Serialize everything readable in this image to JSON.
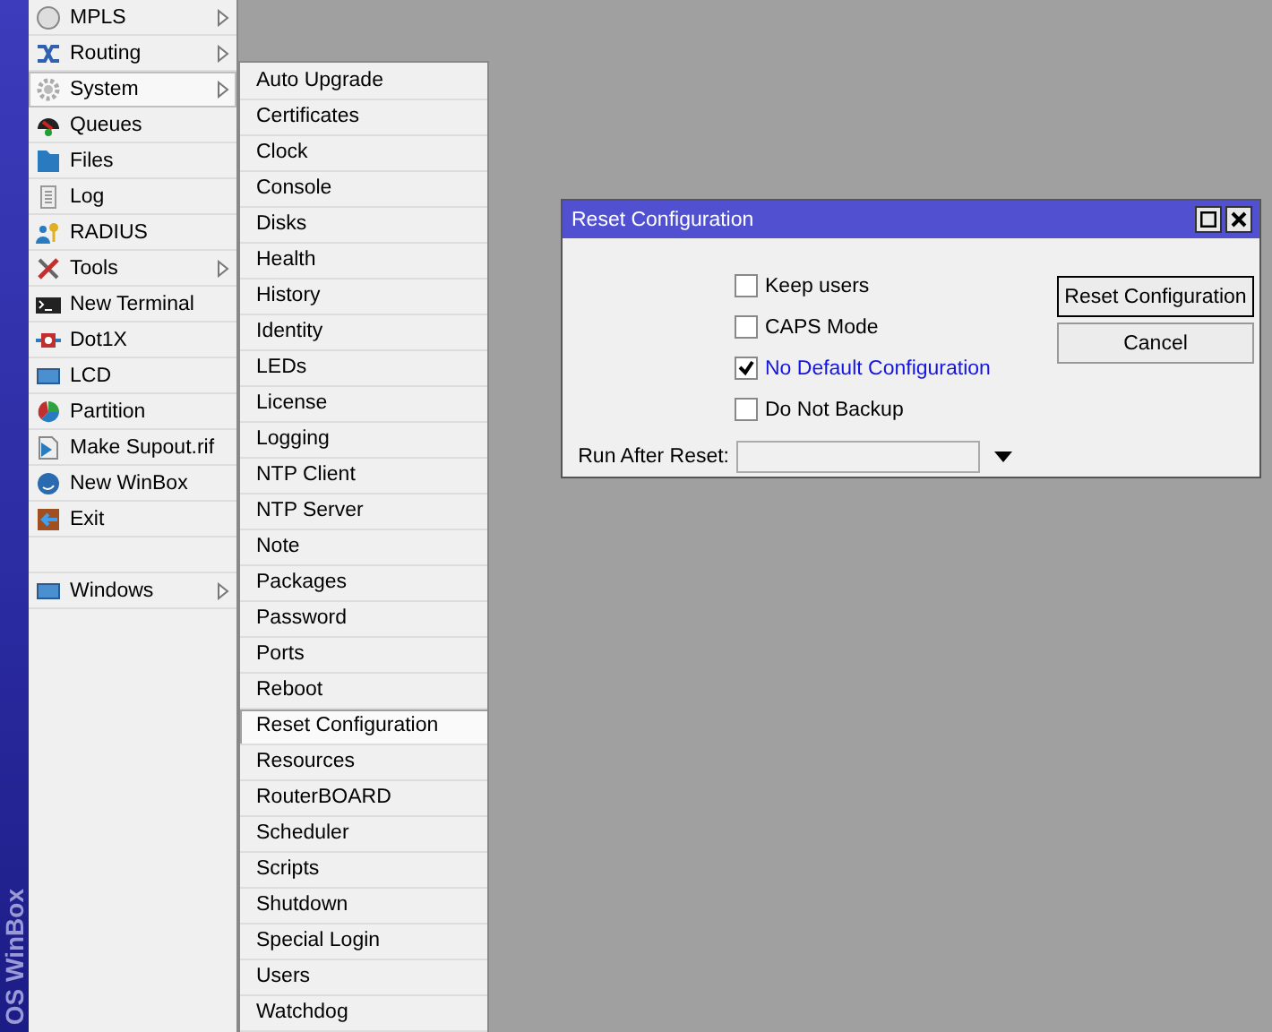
{
  "brand": "OS WinBox",
  "main_menu": [
    {
      "label": "MPLS",
      "has_submenu": true,
      "selected": false
    },
    {
      "label": "Routing",
      "has_submenu": true,
      "selected": false
    },
    {
      "label": "System",
      "has_submenu": true,
      "selected": true
    },
    {
      "label": "Queues",
      "has_submenu": false,
      "selected": false
    },
    {
      "label": "Files",
      "has_submenu": false,
      "selected": false
    },
    {
      "label": "Log",
      "has_submenu": false,
      "selected": false
    },
    {
      "label": "RADIUS",
      "has_submenu": false,
      "selected": false
    },
    {
      "label": "Tools",
      "has_submenu": true,
      "selected": false
    },
    {
      "label": "New Terminal",
      "has_submenu": false,
      "selected": false
    },
    {
      "label": "Dot1X",
      "has_submenu": false,
      "selected": false
    },
    {
      "label": "LCD",
      "has_submenu": false,
      "selected": false
    },
    {
      "label": "Partition",
      "has_submenu": false,
      "selected": false
    },
    {
      "label": "Make Supout.rif",
      "has_submenu": false,
      "selected": false
    },
    {
      "label": "New WinBox",
      "has_submenu": false,
      "selected": false
    },
    {
      "label": "Exit",
      "has_submenu": false,
      "selected": false
    }
  ],
  "bottom_menu": [
    {
      "label": "Windows",
      "has_submenu": true,
      "selected": false
    }
  ],
  "submenu": [
    {
      "label": "Auto Upgrade",
      "selected": false
    },
    {
      "label": "Certificates",
      "selected": false
    },
    {
      "label": "Clock",
      "selected": false
    },
    {
      "label": "Console",
      "selected": false
    },
    {
      "label": "Disks",
      "selected": false
    },
    {
      "label": "Health",
      "selected": false
    },
    {
      "label": "History",
      "selected": false
    },
    {
      "label": "Identity",
      "selected": false
    },
    {
      "label": "LEDs",
      "selected": false
    },
    {
      "label": "License",
      "selected": false
    },
    {
      "label": "Logging",
      "selected": false
    },
    {
      "label": "NTP Client",
      "selected": false
    },
    {
      "label": "NTP Server",
      "selected": false
    },
    {
      "label": "Note",
      "selected": false
    },
    {
      "label": "Packages",
      "selected": false
    },
    {
      "label": "Password",
      "selected": false
    },
    {
      "label": "Ports",
      "selected": false
    },
    {
      "label": "Reboot",
      "selected": false
    },
    {
      "label": "Reset Configuration",
      "selected": true
    },
    {
      "label": "Resources",
      "selected": false
    },
    {
      "label": "RouterBOARD",
      "selected": false
    },
    {
      "label": "Scheduler",
      "selected": false
    },
    {
      "label": "Scripts",
      "selected": false
    },
    {
      "label": "Shutdown",
      "selected": false
    },
    {
      "label": "Special Login",
      "selected": false
    },
    {
      "label": "Users",
      "selected": false
    },
    {
      "label": "Watchdog",
      "selected": false
    }
  ],
  "dialog": {
    "title": "Reset Configuration",
    "options": [
      {
        "label": "Keep users",
        "checked": false
      },
      {
        "label": "CAPS Mode",
        "checked": false
      },
      {
        "label": "No Default Configuration",
        "checked": true
      },
      {
        "label": "Do Not Backup",
        "checked": false
      }
    ],
    "run_after_reset": {
      "label": "Run After Reset:"
    },
    "buttons": [
      {
        "label": "Reset Configuration",
        "default": true
      },
      {
        "label": "Cancel",
        "default": false
      }
    ]
  }
}
